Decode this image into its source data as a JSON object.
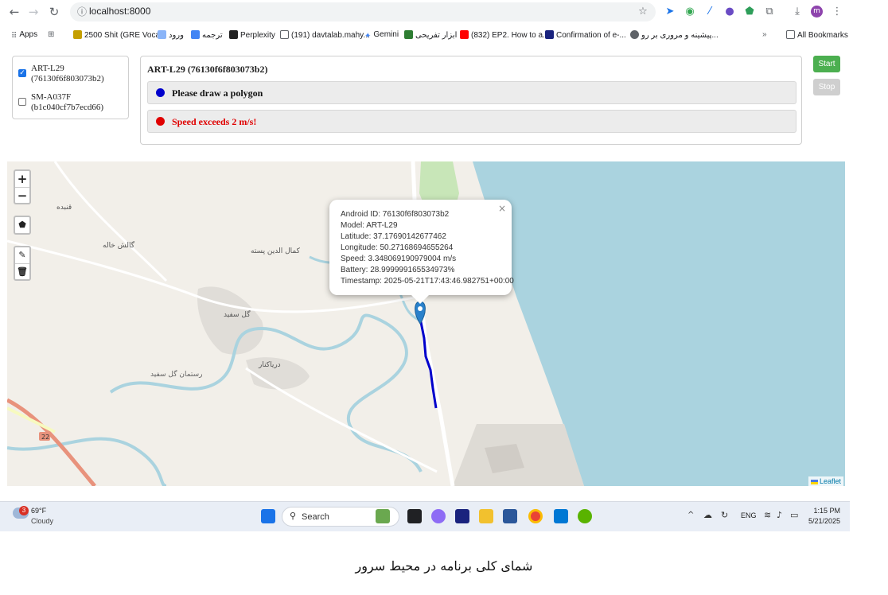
{
  "browser": {
    "url": "localhost:8000",
    "profile_initial": "m"
  },
  "bookmarks": [
    {
      "label": "Apps",
      "icon": "apps-grid-icon",
      "color": "#5f6368"
    },
    {
      "label": "2500 Shit (GRE Voca...",
      "icon": "bookmark-gre-icon",
      "color": "#c59f00"
    },
    {
      "label": "ورود",
      "icon": "bookmark-login-icon",
      "color": "#8ab4f8"
    },
    {
      "label": "ترجمه",
      "icon": "translate-icon",
      "color": "#4285f4"
    },
    {
      "label": "Perplexity",
      "icon": "perplexity-icon",
      "color": "#222222"
    },
    {
      "label": "(191) davtalab.mahy...",
      "icon": "mail-icon",
      "color": "#5f6368"
    },
    {
      "label": "Gemini",
      "icon": "gemini-icon",
      "color": "#4285f4"
    },
    {
      "label": "ابزار تفریحی",
      "icon": "fun-tools-icon",
      "color": "#2e7d32"
    },
    {
      "label": "(832) EP2. How to a...",
      "icon": "youtube-icon",
      "color": "#ff0000"
    },
    {
      "label": "Confirmation of e-...",
      "icon": "confirmation-icon",
      "color": "#1a237e"
    },
    {
      "label": "پیشینه و مروری بر رو...",
      "icon": "globe-icon",
      "color": "#5f6368"
    },
    {
      "label": "All Bookmarks",
      "icon": "folder-icon",
      "color": "#5f6368"
    }
  ],
  "devices": [
    {
      "name": "ART-L29",
      "id": "(76130f6f803073b2)",
      "checked": true
    },
    {
      "name": "SM-A037F",
      "id": "(b1c040cf7b7ecd66)",
      "checked": false
    }
  ],
  "status": {
    "title": "ART-L29 (76130f6f803073b2)",
    "rows": [
      {
        "text": "Please draw a polygon",
        "dot_color": "#0000cc",
        "text_color": "#111111"
      },
      {
        "text": "Speed exceeds 2 m/s!",
        "dot_color": "#e00000",
        "text_color": "#e00000"
      }
    ]
  },
  "controls": {
    "start_label": "Start",
    "stop_label": "Stop"
  },
  "map": {
    "zoom_in": "+",
    "zoom_out": "−",
    "attribution": "Leaflet",
    "popup_lines": [
      "Android ID: 76130f6f803073b2",
      "Model: ART-L29",
      "Latitude: 37.17690142677462",
      "Longitude: 50.27168694655264",
      "Speed: 3.348069190979004 m/s",
      "Battery: 28.999999165534973%",
      "Timestamp: 2025-05-21T17:43:46.982751+00:00"
    ],
    "place_labels": [
      "کمال الدین پسته",
      "گالش خاله",
      "قنبده",
      "گل سفید",
      "رستمان گل سفید",
      "دریاکنار",
      "22"
    ],
    "track_color": "#0000cc"
  },
  "taskbar": {
    "weather_temp": "69°F",
    "weather_desc": "Cloudy",
    "weather_badge": "3",
    "search_label": "Search",
    "lang": "ENG",
    "time": "1:15 PM",
    "date": "5/21/2025"
  },
  "caption": "شمای کلی برنامه در محیط سرور"
}
